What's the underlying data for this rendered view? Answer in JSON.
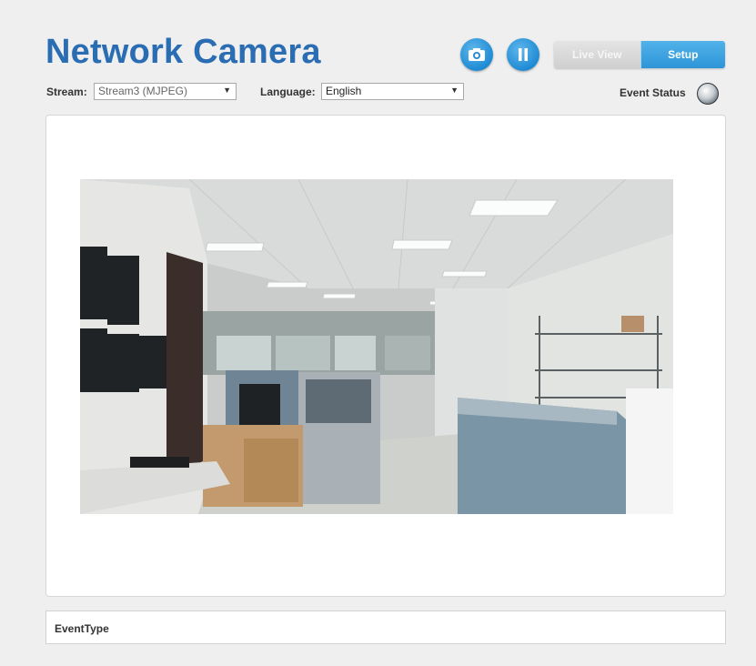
{
  "header": {
    "title": "Network Camera",
    "snapshot_icon": "camera-icon",
    "pause_icon": "pause-icon",
    "modes": {
      "live_view": "Live View",
      "setup": "Setup",
      "active": "Setup"
    }
  },
  "toolbar": {
    "stream_label": "Stream:",
    "stream_value": "Stream3 (MJPEG)",
    "language_label": "Language:",
    "language_value": "English",
    "event_status_label": "Event Status"
  },
  "video": {
    "description_icon": "live-video-feed"
  },
  "event_panel": {
    "label": "EventType"
  },
  "colors": {
    "accent": "#2a6db3",
    "button_blue": "#2d95d7",
    "panel_bg": "#ffffff",
    "page_bg": "#efefef"
  }
}
